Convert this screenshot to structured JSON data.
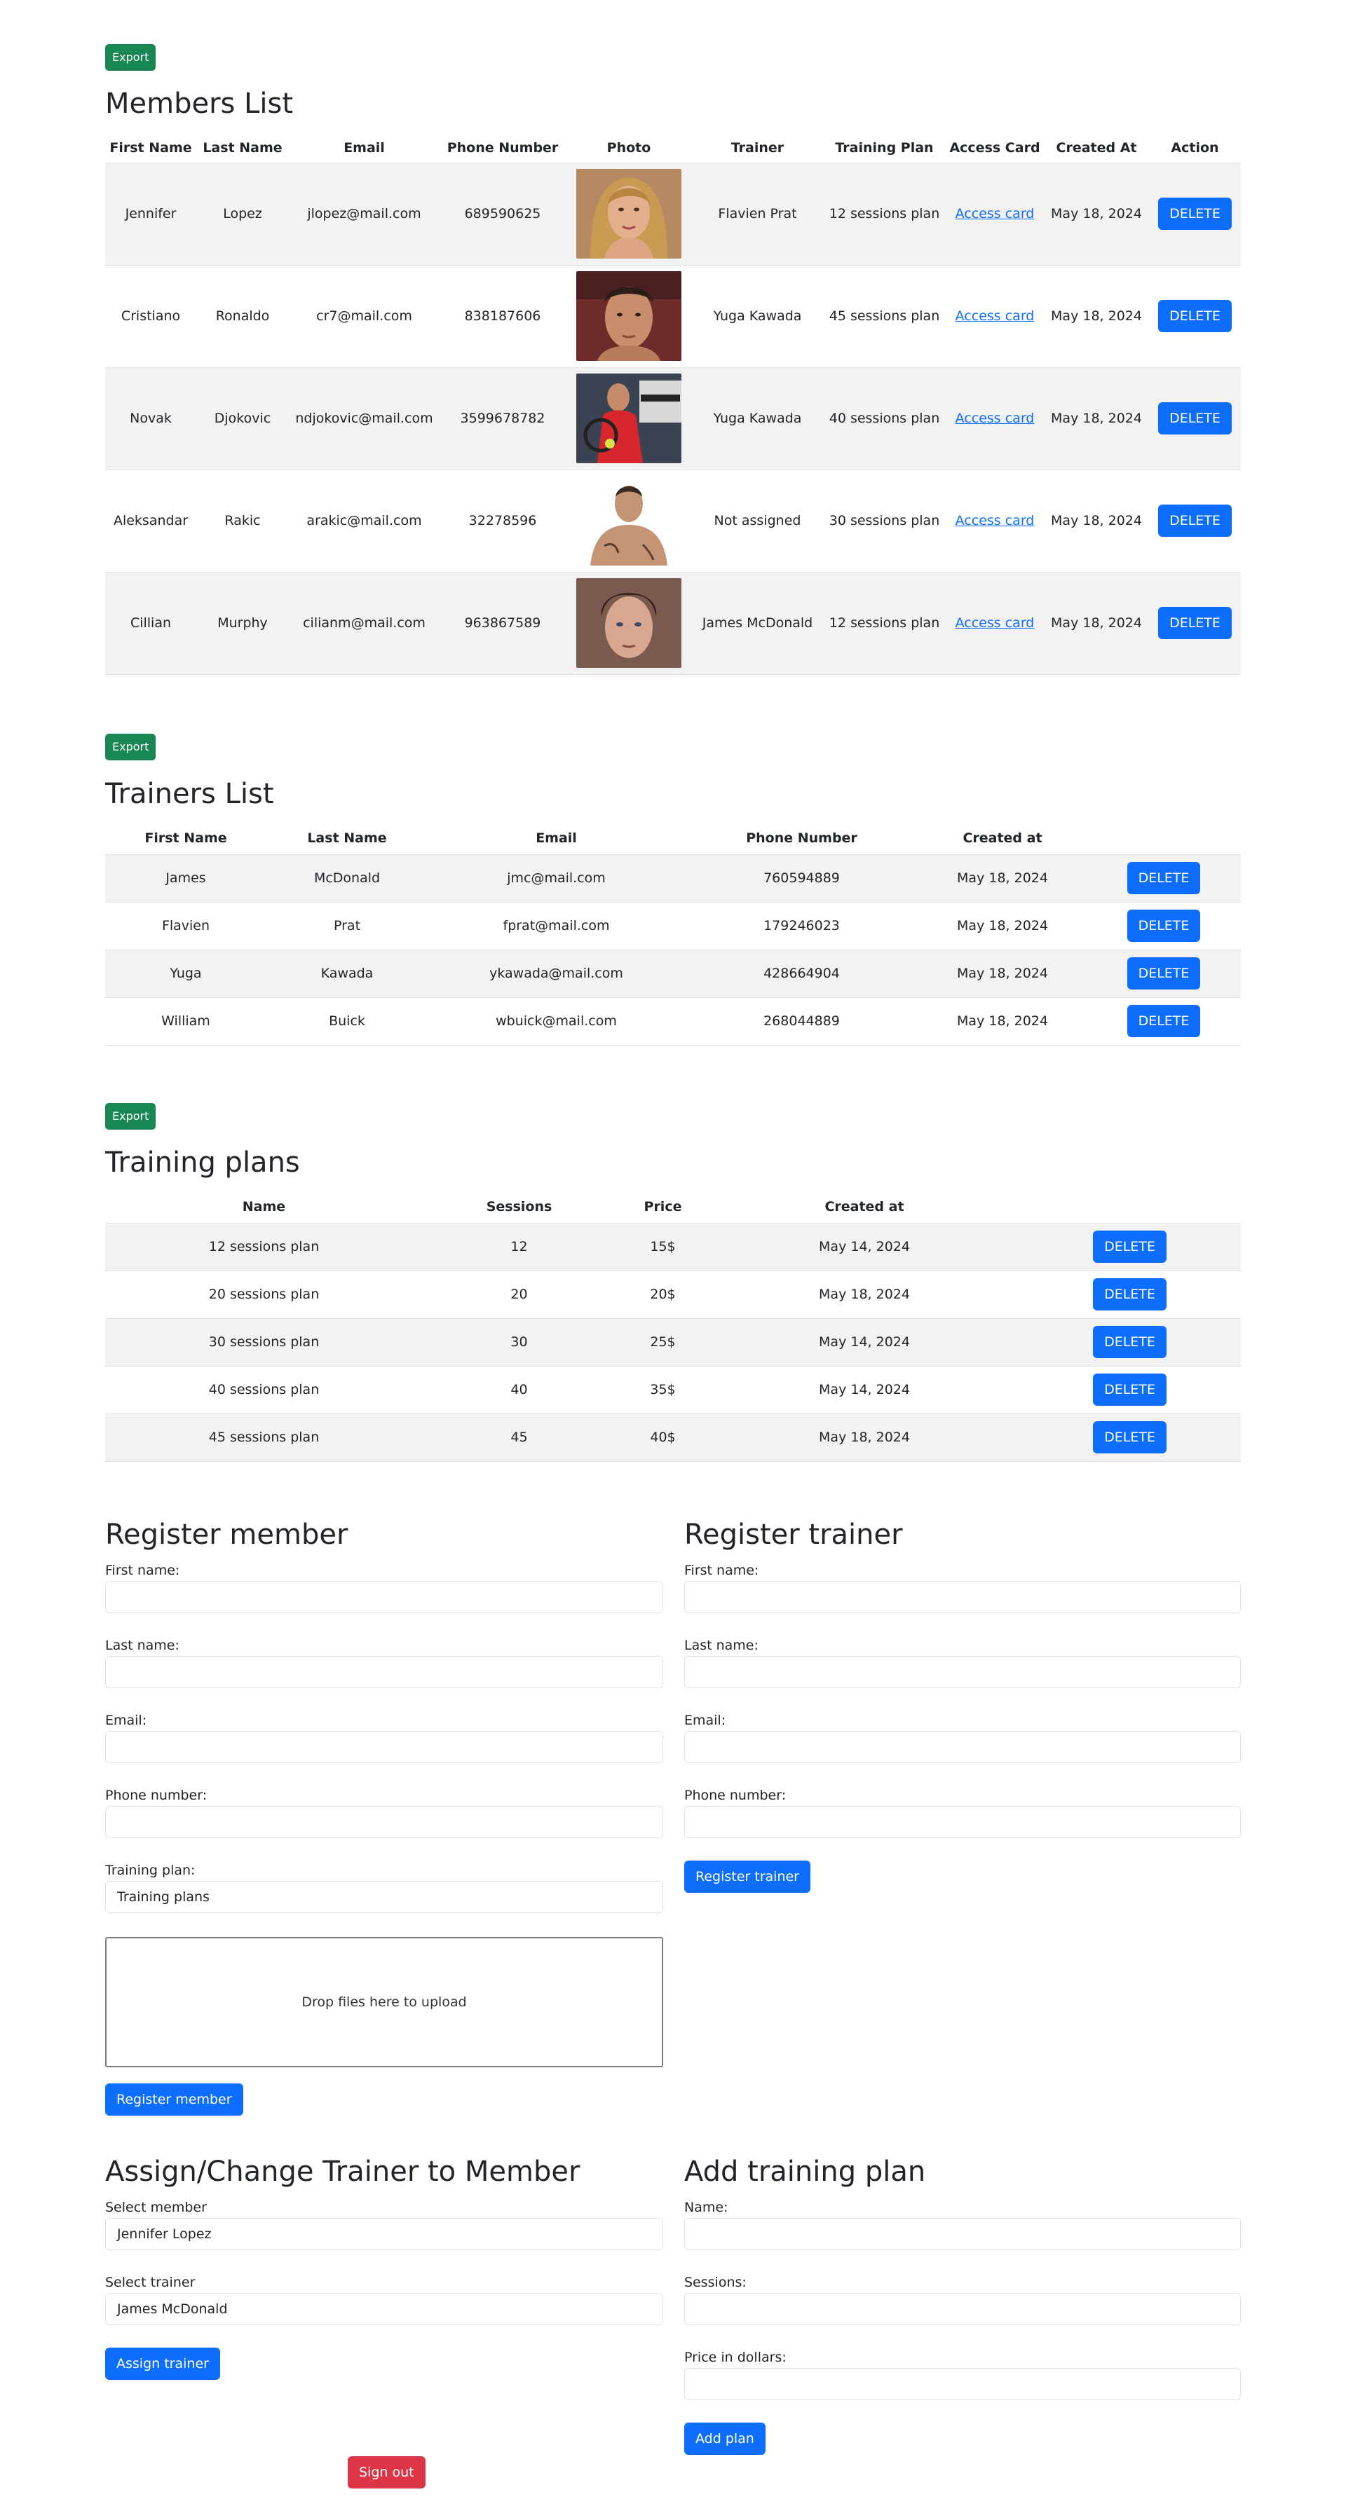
{
  "members": {
    "export_label": "Export",
    "title": "Members List",
    "columns": [
      "First Name",
      "Last Name",
      "Email",
      "Phone Number",
      "Photo",
      "Trainer",
      "Training Plan",
      "Access Card",
      "Created At",
      "Action"
    ],
    "rows": [
      {
        "first": "Jennifer",
        "last": "Lopez",
        "email": "jlopez@mail.com",
        "phone": "689590625",
        "photo": "photo-jennifer-lopez",
        "trainer": "Flavien Prat",
        "plan": "12 sessions plan",
        "card": "Access card",
        "created": "May 18, 2024",
        "action": "DELETE"
      },
      {
        "first": "Cristiano",
        "last": "Ronaldo",
        "email": "cr7@mail.com",
        "phone": "838187606",
        "photo": "photo-cristiano-ronaldo",
        "trainer": "Yuga Kawada",
        "plan": "45 sessions plan",
        "card": "Access card",
        "created": "May 18, 2024",
        "action": "DELETE"
      },
      {
        "first": "Novak",
        "last": "Djokovic",
        "email": "ndjokovic@mail.com",
        "phone": "3599678782",
        "photo": "photo-novak-djokovic",
        "trainer": "Yuga Kawada",
        "plan": "40 sessions plan",
        "card": "Access card",
        "created": "May 18, 2024",
        "action": "DELETE"
      },
      {
        "first": "Aleksandar",
        "last": "Rakic",
        "email": "arakic@mail.com",
        "phone": "32278596",
        "photo": "photo-aleksandar-rakic",
        "trainer": "Not assigned",
        "plan": "30 sessions plan",
        "card": "Access card",
        "created": "May 18, 2024",
        "action": "DELETE"
      },
      {
        "first": "Cillian",
        "last": "Murphy",
        "email": "cilianm@mail.com",
        "phone": "963867589",
        "photo": "photo-cillian-murphy",
        "trainer": "James McDonald",
        "plan": "12 sessions plan",
        "card": "Access card",
        "created": "May 18, 2024",
        "action": "DELETE"
      }
    ]
  },
  "trainers": {
    "export_label": "Export",
    "title": "Trainers List",
    "columns": [
      "First Name",
      "Last Name",
      "Email",
      "Phone Number",
      "Created at",
      ""
    ],
    "rows": [
      {
        "first": "James",
        "last": "McDonald",
        "email": "jmc@mail.com",
        "phone": "760594889",
        "created": "May 18, 2024",
        "action": "DELETE"
      },
      {
        "first": "Flavien",
        "last": "Prat",
        "email": "fprat@mail.com",
        "phone": "179246023",
        "created": "May 18, 2024",
        "action": "DELETE"
      },
      {
        "first": "Yuga",
        "last": "Kawada",
        "email": "ykawada@mail.com",
        "phone": "428664904",
        "created": "May 18, 2024",
        "action": "DELETE"
      },
      {
        "first": "William",
        "last": "Buick",
        "email": "wbuick@mail.com",
        "phone": "268044889",
        "created": "May 18, 2024",
        "action": "DELETE"
      }
    ]
  },
  "plans": {
    "export_label": "Export",
    "title": "Training plans",
    "columns": [
      "Name",
      "Sessions",
      "Price",
      "Created at",
      ""
    ],
    "rows": [
      {
        "name": "12 sessions plan",
        "sessions": "12",
        "price": "15$",
        "created": "May 14, 2024",
        "action": "DELETE"
      },
      {
        "name": "20 sessions plan",
        "sessions": "20",
        "price": "20$",
        "created": "May 18, 2024",
        "action": "DELETE"
      },
      {
        "name": "30 sessions plan",
        "sessions": "30",
        "price": "25$",
        "created": "May 14, 2024",
        "action": "DELETE"
      },
      {
        "name": "40 sessions plan",
        "sessions": "40",
        "price": "35$",
        "created": "May 14, 2024",
        "action": "DELETE"
      },
      {
        "name": "45 sessions plan",
        "sessions": "45",
        "price": "40$",
        "created": "May 18, 2024",
        "action": "DELETE"
      }
    ]
  },
  "register_member": {
    "title": "Register member",
    "first_name_label": "First name:",
    "first_name_value": "",
    "last_name_label": "Last name:",
    "last_name_value": "",
    "email_label": "Email:",
    "email_value": "",
    "phone_label": "Phone number:",
    "phone_value": "",
    "plan_label": "Training plan:",
    "plan_selected": "Training plans",
    "dropzone_text": "Drop files here to upload",
    "submit_label": "Register member"
  },
  "register_trainer": {
    "title": "Register trainer",
    "first_name_label": "First name:",
    "first_name_value": "",
    "last_name_label": "Last name:",
    "last_name_value": "",
    "email_label": "Email:",
    "email_value": "",
    "phone_label": "Phone number:",
    "phone_value": "",
    "submit_label": "Register trainer"
  },
  "assign_trainer": {
    "title": "Assign/Change Trainer to Member",
    "member_label": "Select member",
    "member_selected": "Jennifer Lopez",
    "trainer_label": "Select trainer",
    "trainer_selected": "James McDonald",
    "submit_label": "Assign trainer"
  },
  "add_plan": {
    "title": "Add training plan",
    "name_label": "Name:",
    "name_value": "",
    "sessions_label": "Sessions:",
    "sessions_value": "",
    "price_label": "Price in dollars:",
    "price_value": "",
    "submit_label": "Add plan"
  },
  "signout_label": "Sign out",
  "colors": {
    "primary": "#0d6efd",
    "success": "#198754",
    "danger": "#dc3545",
    "stripe": "#f2f2f2",
    "text": "#212529"
  }
}
